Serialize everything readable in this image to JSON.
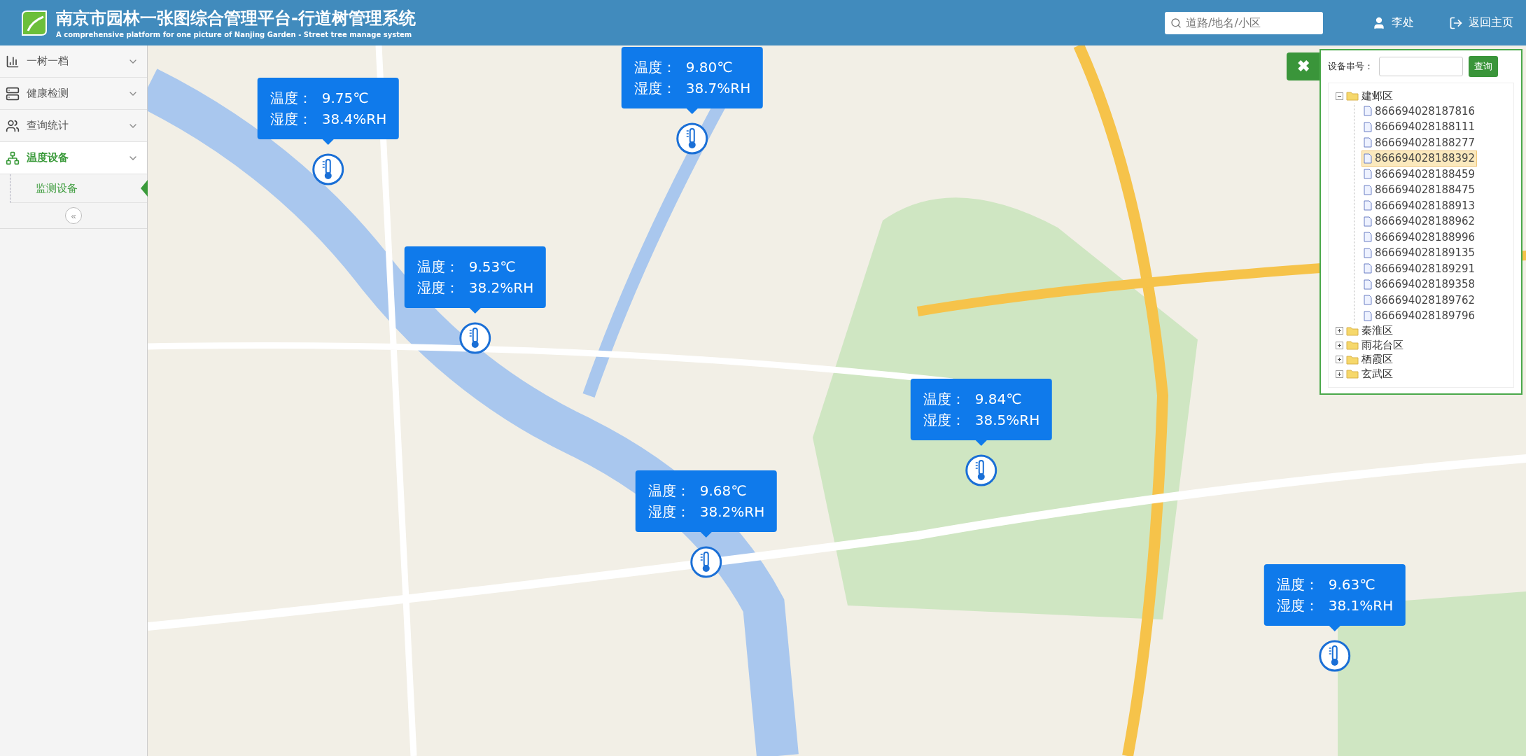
{
  "header": {
    "title": "南京市园林一张图综合管理平台-行道树管理系统",
    "subtitle": "A comprehensive platform for one picture of Nanjing Garden - Street tree manage system",
    "search": {
      "placeholder": "道路/地名/小区"
    },
    "user": "李处",
    "home_link": "返回主页"
  },
  "sidebar": {
    "items": [
      {
        "label": "一树一档",
        "kind": "chart",
        "selected": false
      },
      {
        "label": "健康检测",
        "kind": "server",
        "selected": false
      },
      {
        "label": "查询统计",
        "kind": "users",
        "selected": false
      },
      {
        "label": "温度设备",
        "kind": "sitemap",
        "selected": true,
        "children": [
          {
            "label": "监测设备",
            "selected": true
          }
        ]
      }
    ],
    "collapse": "«"
  },
  "map": {
    "sensors": [
      {
        "temperature_label": "温度：",
        "temperature": "9.75℃",
        "humidity_label": "湿度：",
        "humidity": "38.4%RH"
      },
      {
        "temperature_label": "温度：",
        "temperature": "9.80℃",
        "humidity_label": "湿度：",
        "humidity": "38.7%RH"
      },
      {
        "temperature_label": "温度：",
        "temperature": "9.53℃",
        "humidity_label": "湿度：",
        "humidity": "38.2%RH"
      },
      {
        "temperature_label": "温度：",
        "temperature": "9.84℃",
        "humidity_label": "湿度：",
        "humidity": "38.5%RH"
      },
      {
        "temperature_label": "温度：",
        "temperature": "9.68℃",
        "humidity_label": "湿度：",
        "humidity": "38.2%RH"
      },
      {
        "temperature_label": "温度：",
        "temperature": "9.63℃",
        "humidity_label": "湿度：",
        "humidity": "38.1%RH"
      }
    ]
  },
  "device_panel": {
    "close": "✖",
    "serial_label": "设备串号：",
    "query_button": "查询",
    "tree": [
      {
        "label": "建邺区",
        "expanded": true,
        "children": [
          {
            "label": "866694028187816",
            "selected": false
          },
          {
            "label": "866694028188111",
            "selected": false
          },
          {
            "label": "866694028188277",
            "selected": false
          },
          {
            "label": "866694028188392",
            "selected": true
          },
          {
            "label": "866694028188459",
            "selected": false
          },
          {
            "label": "866694028188475",
            "selected": false
          },
          {
            "label": "866694028188913",
            "selected": false
          },
          {
            "label": "866694028188962",
            "selected": false
          },
          {
            "label": "866694028188996",
            "selected": false
          },
          {
            "label": "866694028189135",
            "selected": false
          },
          {
            "label": "866694028189291",
            "selected": false
          },
          {
            "label": "866694028189358",
            "selected": false
          },
          {
            "label": "866694028189762",
            "selected": false
          },
          {
            "label": "866694028189796",
            "selected": false
          }
        ]
      },
      {
        "label": "秦淮区",
        "expanded": false
      },
      {
        "label": "雨花台区",
        "expanded": false
      },
      {
        "label": "栖霞区",
        "expanded": false
      },
      {
        "label": "玄武区",
        "expanded": false
      }
    ]
  }
}
